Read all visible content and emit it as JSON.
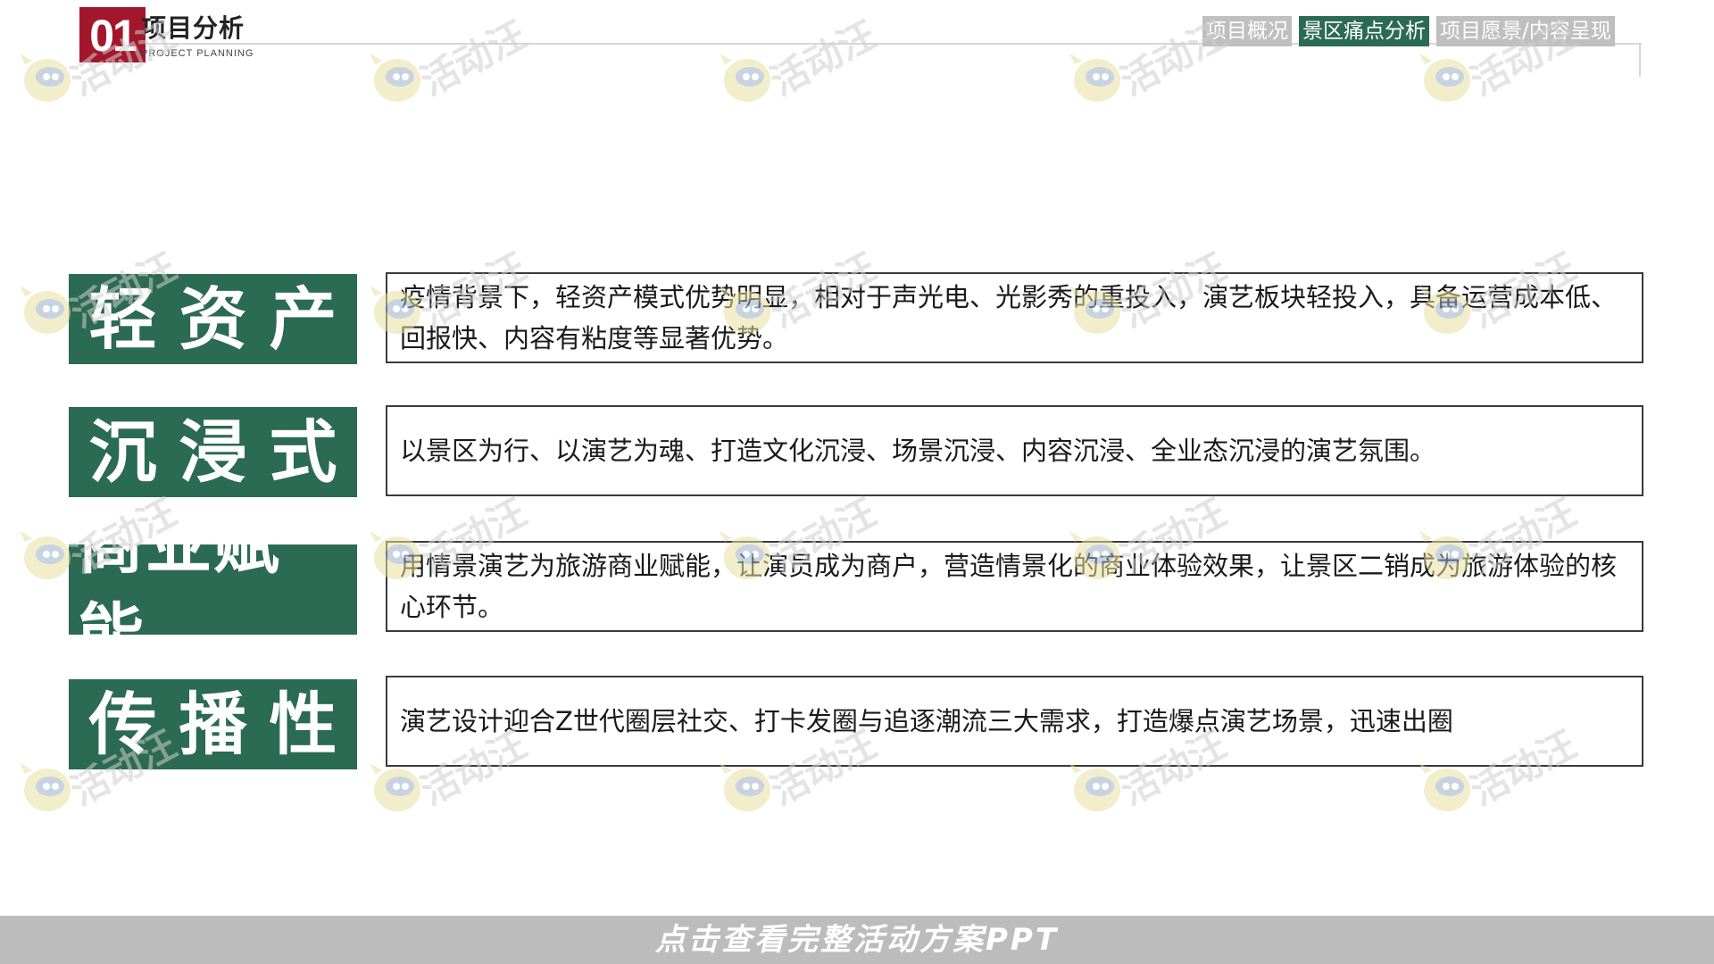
{
  "header": {
    "number": "01",
    "title": "项目分析",
    "subtitle": "PROJECT PLANNING"
  },
  "nav": {
    "tabs": [
      {
        "label": "项目概况",
        "active": false
      },
      {
        "label": "景区痛点分析",
        "active": true
      },
      {
        "label": "项目愿景/内容呈现",
        "active": false
      }
    ]
  },
  "rows": [
    {
      "label": "轻资产",
      "text": "疫情背景下，轻资产模式优势明显，相对于声光电、光影秀的重投入，演艺板块轻投入，具备运营成本低、回报快、内容有粘度等显著优势。"
    },
    {
      "label": "沉浸式",
      "text": "以景区为行、以演艺为魂、打造文化沉浸、场景沉浸、内容沉浸、全业态沉浸的演艺氛围。"
    },
    {
      "label": "商业赋能",
      "text": "用情景演艺为旅游商业赋能，让演员成为商户，营造情景化的商业体验效果，让景区二销成为旅游体验的核心环节。"
    },
    {
      "label": "传播性",
      "text": "演艺设计迎合Z世代圈层社交、打卡发圈与追逐潮流三大需求，打造爆点演艺场景，迅速出圈"
    }
  ],
  "watermark": {
    "text": "活动汪",
    "icon": "mascot-logo-icon"
  },
  "footer": {
    "label": "点击查看完整活动方案PPT"
  },
  "colors": {
    "accent_red": "#a3172c",
    "accent_green": "#2b6a53",
    "tab_gray": "#bfbfbf",
    "footer_gray": "#bcbcbc"
  }
}
